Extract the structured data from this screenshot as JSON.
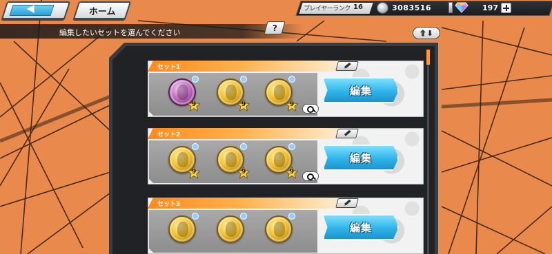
{
  "header": {
    "home_label": "ホーム",
    "player_rank_label": "プレイヤーランク",
    "player_rank_value": "16",
    "coins": "3083516",
    "gems": "197"
  },
  "instruction": {
    "text": "編集したいセットを選んでください",
    "help_label": "?"
  },
  "sort": {
    "up": "⇧",
    "down": "⬇"
  },
  "sets": [
    {
      "name": "セット1",
      "edit_label": "編集",
      "medals": [
        {
          "color": "purple",
          "stars": "9"
        },
        {
          "color": "gold",
          "stars": "9"
        },
        {
          "color": "gold",
          "stars": "9"
        }
      ]
    },
    {
      "name": "セット2",
      "edit_label": "編集",
      "medals": [
        {
          "color": "gold",
          "stars": "9"
        },
        {
          "color": "gold",
          "stars": "9"
        },
        {
          "color": "gold",
          "stars": "9"
        }
      ]
    },
    {
      "name": "セット3",
      "edit_label": "編集",
      "medals": [
        {
          "color": "gold",
          "stars": ""
        },
        {
          "color": "gold",
          "stars": ""
        },
        {
          "color": "gold",
          "stars": ""
        }
      ]
    }
  ],
  "colors": {
    "background": "#e98a4c",
    "accent_orange": "#ff8a1e",
    "edit_blue": "#2fb4e9"
  }
}
